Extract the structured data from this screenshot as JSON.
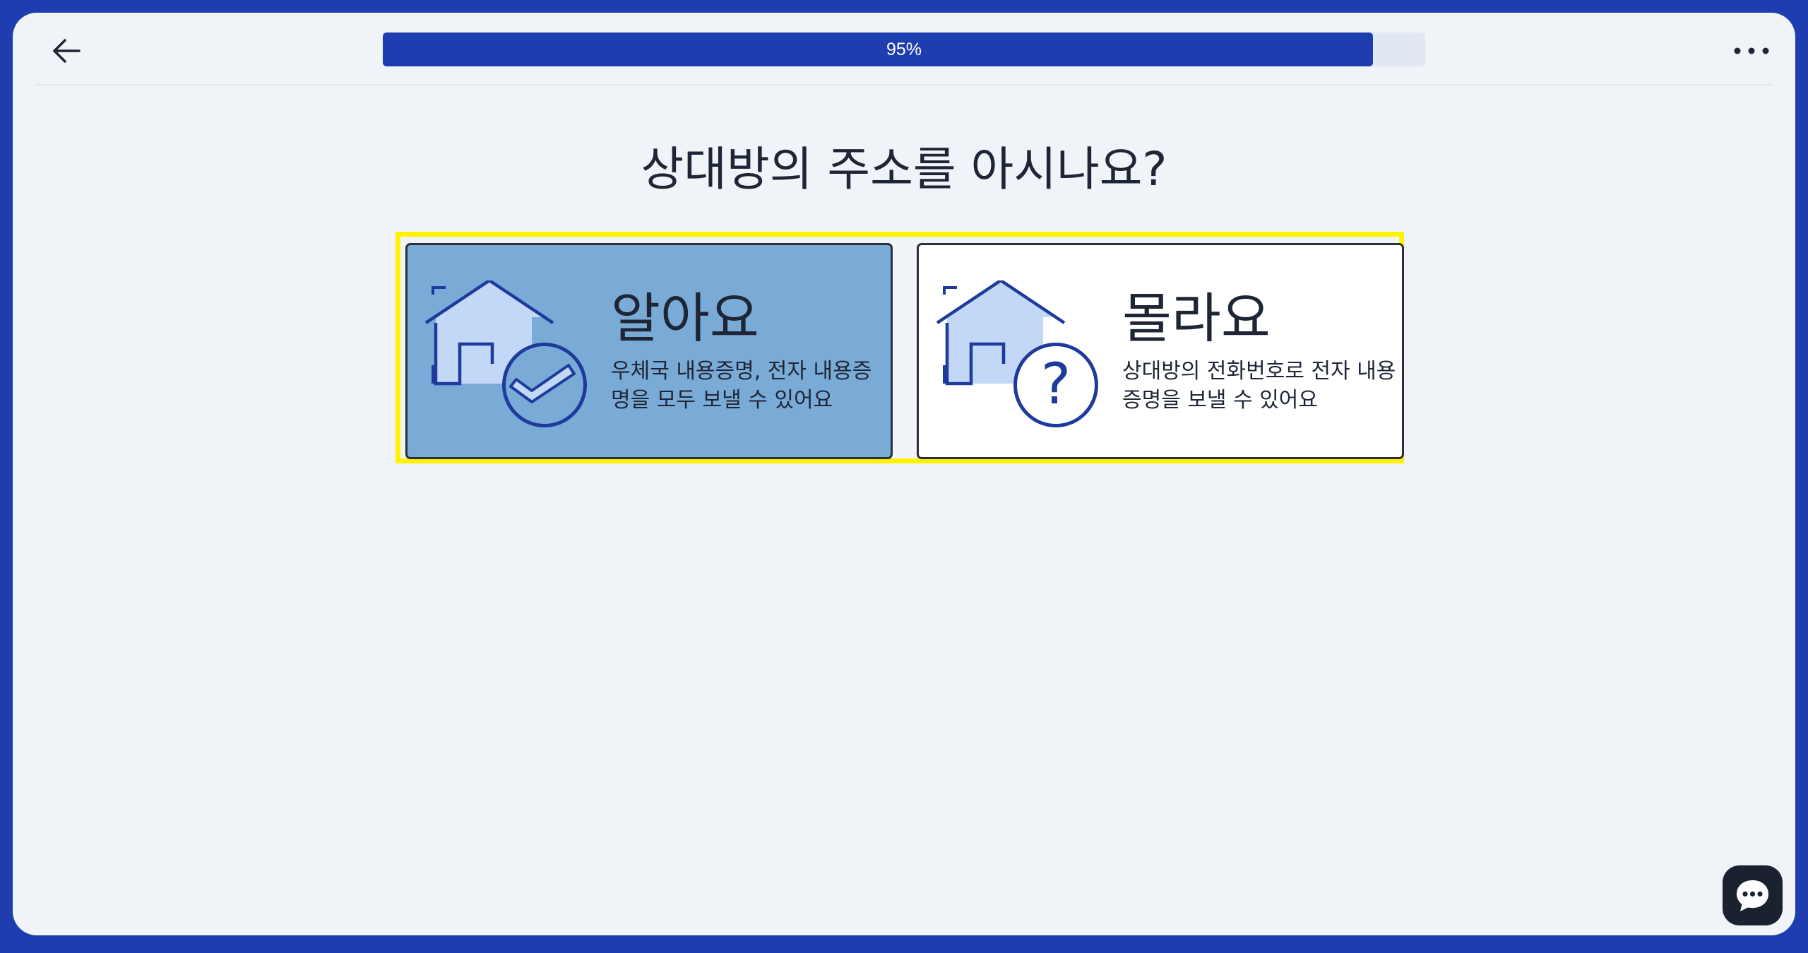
{
  "header": {
    "back_icon": "arrow-left-icon",
    "progress": {
      "percent": 95,
      "label": "95%"
    },
    "more_icon": "more-horizontal-icon"
  },
  "question": {
    "title": "상대방의 주소를 아시나요?"
  },
  "options": [
    {
      "title": "알아요",
      "description": "우체국 내용증명, 전자 내용증명을 모두 보낼 수 있어요",
      "icon": "house-check-icon",
      "selected": true
    },
    {
      "title": "몰라요",
      "description": "상대방의 전화번호로 전자 내용증명을 보낼 수 있어요",
      "icon": "house-question-icon",
      "selected": false
    }
  ],
  "chat": {
    "icon": "chat-bubble-icon"
  },
  "colors": {
    "brand": "#1e3eb0",
    "selected_card": "#7aaad6",
    "highlight": "#fff200",
    "text": "#1e2535"
  }
}
